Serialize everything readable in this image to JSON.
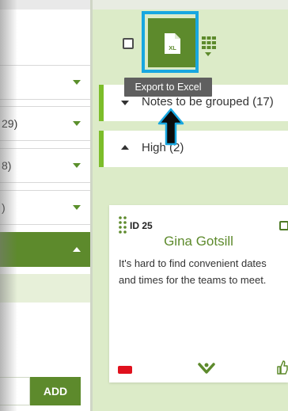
{
  "left_panel": {
    "dropdowns": [
      {
        "value": ""
      },
      {
        "value": "29)"
      },
      {
        "value": "8)"
      },
      {
        "value": ")"
      },
      {
        "value": ""
      }
    ],
    "add_button_label": "ADD"
  },
  "toolbar": {
    "export_tooltip": "Export to Excel",
    "excel_icon_text": "XL"
  },
  "groups": [
    {
      "label": "Notes to be grouped (17)",
      "expanded": false
    },
    {
      "label": "High (2)",
      "expanded": true
    }
  ],
  "card": {
    "id_label": "ID 25",
    "name": "Gina Gotsill",
    "text": "It's hard to find convenient dates and times for the teams to meet.",
    "flag_color": "#e0111d"
  },
  "colors": {
    "accent_green": "#5d8a2c",
    "bright_green": "#7cbd2a",
    "panel_bg": "#dcebc8",
    "highlight_blue": "#18a7e0"
  }
}
